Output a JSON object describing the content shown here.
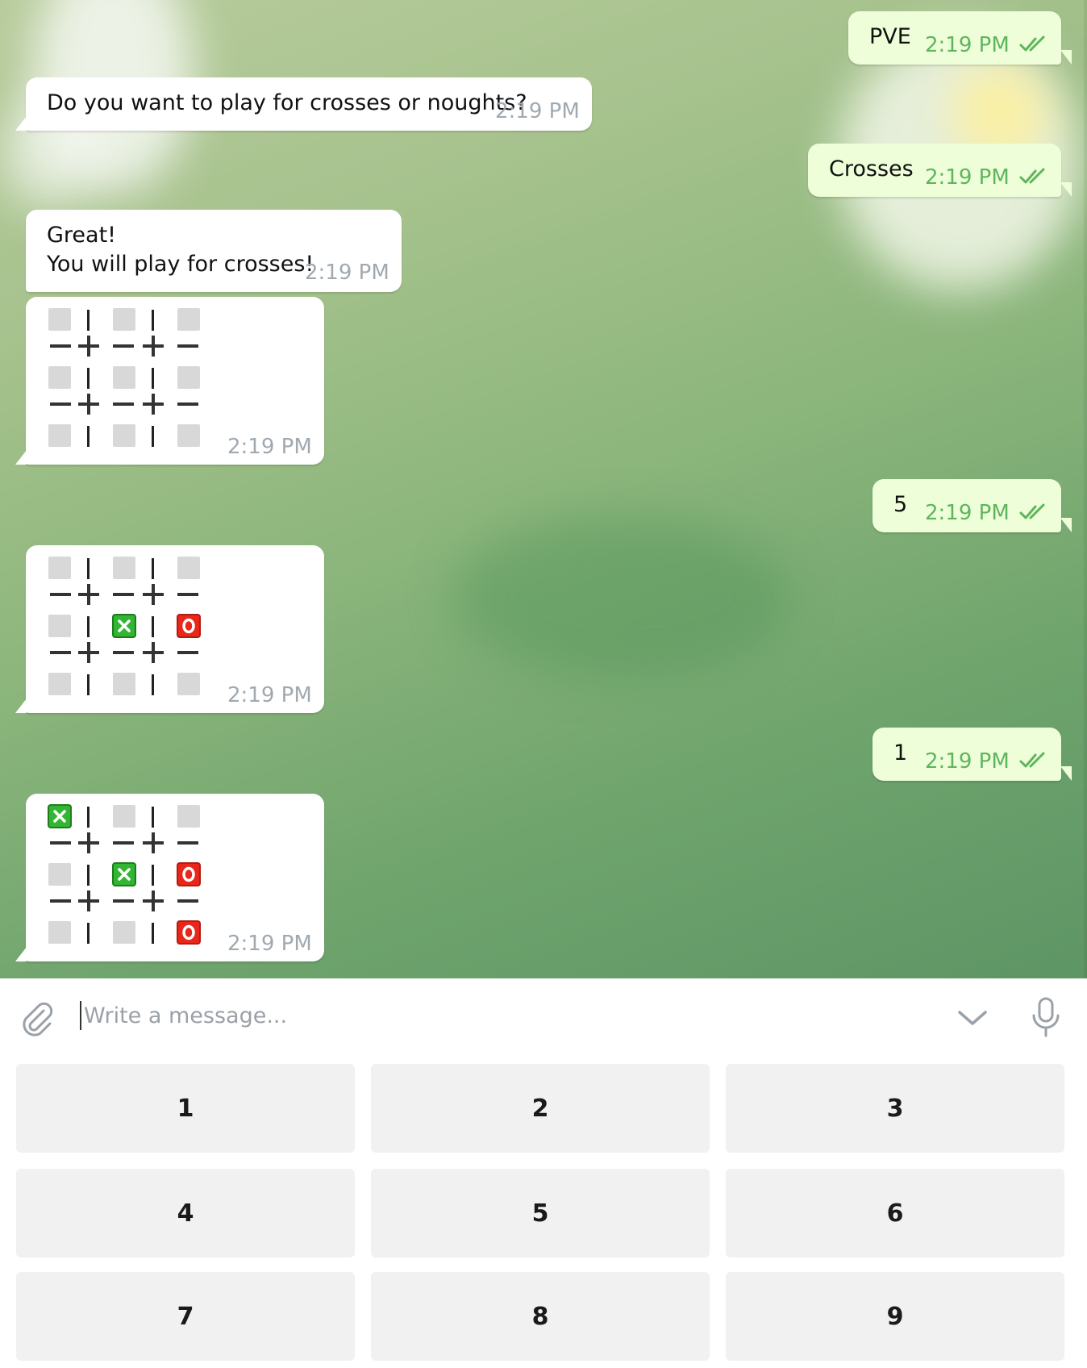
{
  "messages": [
    {
      "text": "PVE",
      "time": "2:19 PM"
    },
    {
      "text": "Do you want to play for crosses or noughts?",
      "time": "2:19 PM"
    },
    {
      "text": "Crosses",
      "time": "2:19 PM"
    },
    {
      "line1": "Great!",
      "line2": "You will play for crosses!",
      "time": "2:19 PM"
    },
    {
      "board": [
        "empty",
        "empty",
        "empty",
        "empty",
        "empty",
        "empty",
        "empty",
        "empty",
        "empty"
      ],
      "time": "2:19 PM"
    },
    {
      "text": "5",
      "time": "2:19 PM"
    },
    {
      "board": [
        "empty",
        "empty",
        "empty",
        "empty",
        "x",
        "o",
        "empty",
        "empty",
        "empty"
      ],
      "time": "2:19 PM"
    },
    {
      "text": "1",
      "time": "2:19 PM"
    },
    {
      "board": [
        "x",
        "empty",
        "empty",
        "empty",
        "x",
        "o",
        "empty",
        "empty",
        "o"
      ],
      "time": "2:19 PM"
    }
  ],
  "composer": {
    "placeholder": "Write a message...",
    "icons": [
      "paperclip-icon",
      "chevron-down-icon",
      "microphone-icon"
    ]
  },
  "keyboard": {
    "keys": [
      "1",
      "2",
      "3",
      "4",
      "5",
      "6",
      "7",
      "8",
      "9"
    ]
  },
  "colors": {
    "incoming_bubble": "#ffffff",
    "outgoing_bubble": "#eefed8",
    "outgoing_time": "#5eb55e",
    "incoming_time": "#a1a9b0",
    "cross_cell": "#32b532",
    "nought_cell": "#e8261a",
    "empty_cell": "#d8d8d8",
    "key_background": "#f1f1f1"
  }
}
